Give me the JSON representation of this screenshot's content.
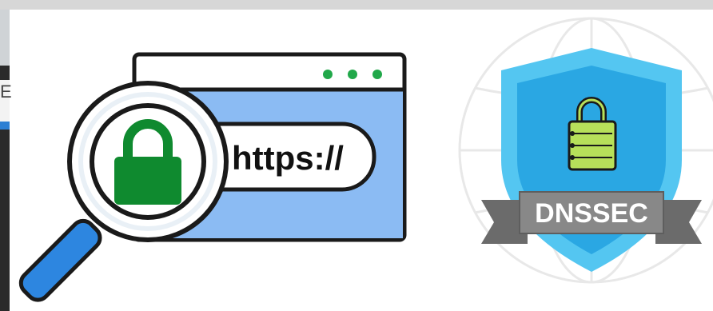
{
  "left_fragment": "E",
  "browser_illustration": {
    "url_text": "https://",
    "icons": [
      "browser-window-icon",
      "magnifying-glass-icon",
      "padlock-icon"
    ],
    "colors": {
      "window_blue": "#8bbbf3",
      "lock_green": "#0f8a2f",
      "dots_green": "#21a84a",
      "handle_blue": "#2d86e0"
    }
  },
  "dnssec_badge": {
    "label": "DNSSEC",
    "icons": [
      "shield-icon",
      "padlock-icon",
      "globe-icon"
    ],
    "colors": {
      "shield_outer": "#54c6f1",
      "shield_inner": "#2aa7e3",
      "lock_body": "#b7e05a",
      "ribbon": "#7c7c7c"
    }
  }
}
